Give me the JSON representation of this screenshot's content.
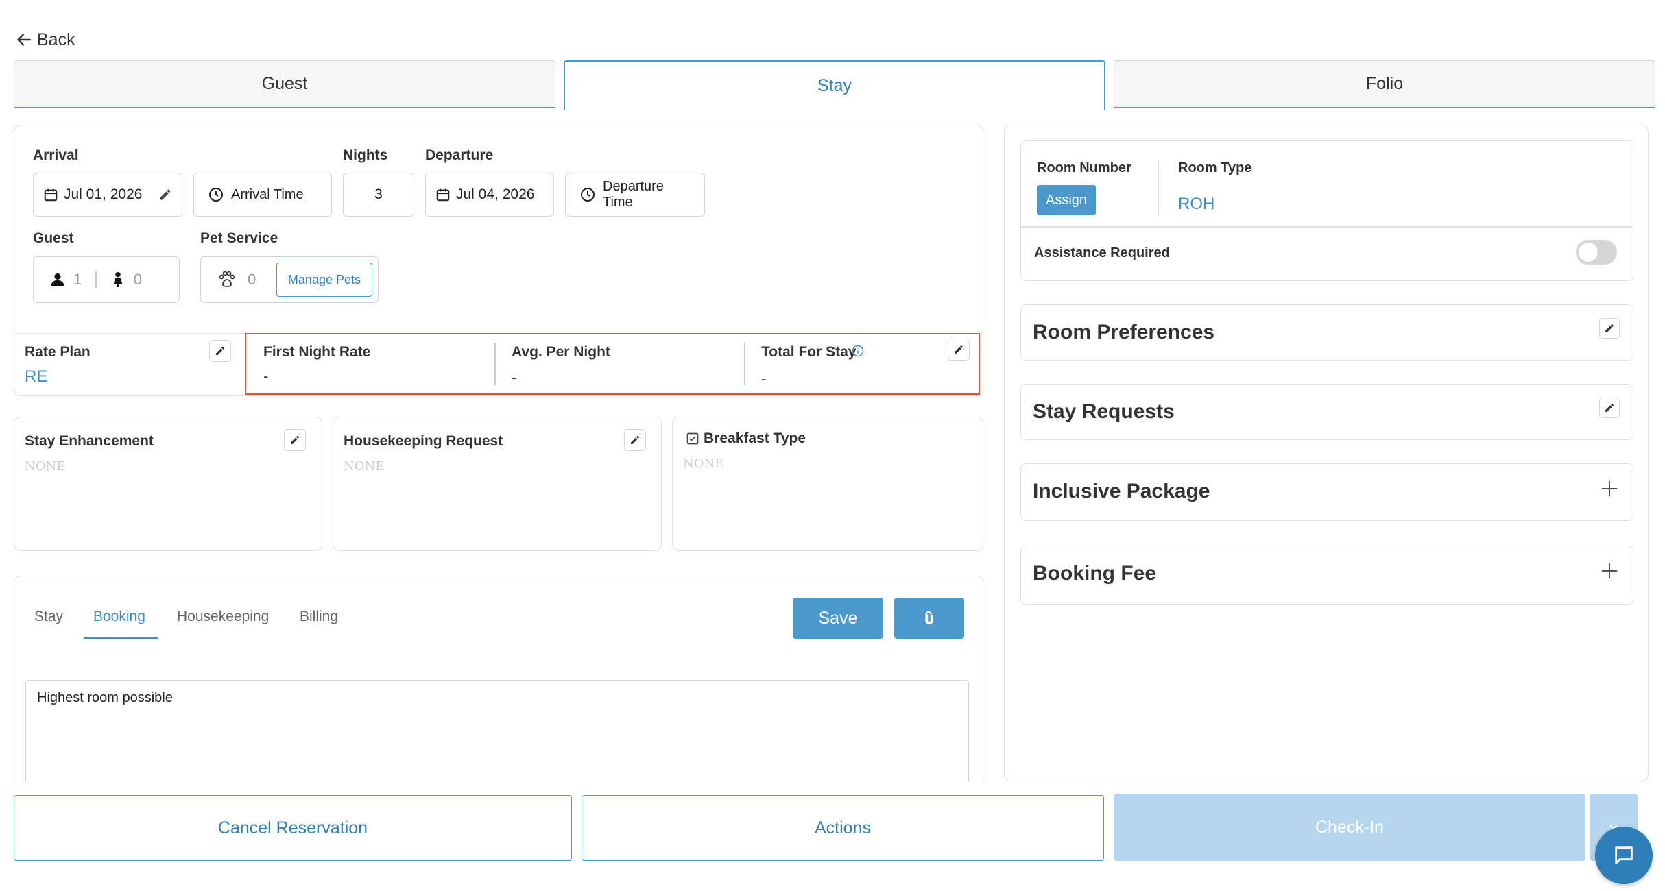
{
  "nav": {
    "back_label": "Back"
  },
  "tabs": [
    {
      "label": "Guest"
    },
    {
      "label": "Stay"
    },
    {
      "label": "Folio"
    }
  ],
  "stay": {
    "arrival_label": "Arrival",
    "arrival_date": "Jul 01, 2026",
    "arrival_time_label": "Arrival Time",
    "nights_label": "Nights",
    "nights": "3",
    "departure_label": "Departure",
    "departure_date": "Jul 04, 2026",
    "departure_time_label": "Departure Time",
    "guest_label": "Guest",
    "adults": "1",
    "children": "0",
    "pet_label": "Pet Service",
    "pets": "0",
    "manage_pets_label": "Manage Pets"
  },
  "rates": {
    "rate_plan_label": "Rate Plan",
    "rate_plan_value": "RE",
    "first_night_label": "First Night Rate",
    "first_night_value": "-",
    "avg_label": "Avg. Per Night",
    "avg_value": "-",
    "total_label": "Total For Stay",
    "total_value": "-"
  },
  "extras": {
    "enhancement_label": "Stay Enhancement",
    "enhancement_value": "NONE",
    "housekeeping_label": "Housekeeping Request",
    "housekeeping_value": "NONE",
    "breakfast_label": "Breakfast Type",
    "breakfast_value": "NONE"
  },
  "notes": {
    "tabs": [
      "Stay",
      "Booking",
      "Housekeeping",
      "Billing"
    ],
    "active_tab": "Booking",
    "save_label": "Save",
    "text": "Highest room possible"
  },
  "room": {
    "room_number_label": "Room Number",
    "assign_label": "Assign",
    "room_type_label": "Room Type",
    "room_type_value": "ROH",
    "assistance_label": "Assistance Required",
    "assistance_on": false
  },
  "cards": {
    "preferences": "Room Preferences",
    "requests": "Stay Requests",
    "package": "Inclusive Package",
    "fee": "Booking Fee"
  },
  "actions": {
    "cancel_label": "Cancel Reservation",
    "actions_label": "Actions",
    "checkin_label": "Check-In"
  },
  "colors": {
    "accent": "#4a98cc",
    "highlight_border": "#e0513a",
    "checkin_disabled": "#b5d6ee"
  }
}
